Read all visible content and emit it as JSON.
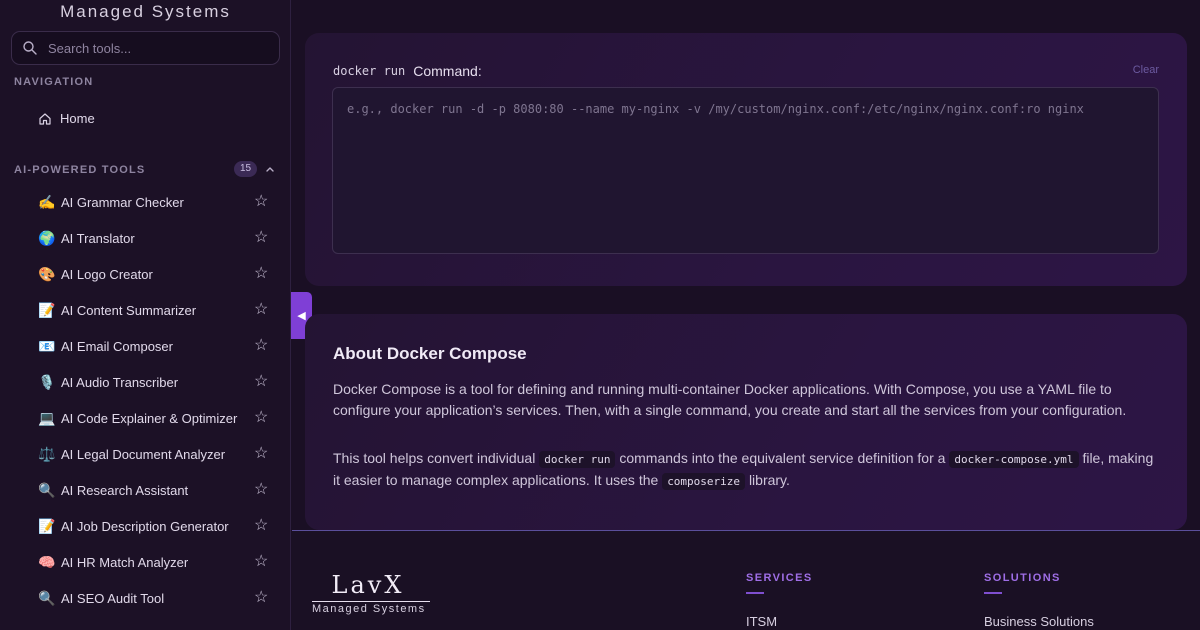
{
  "sidebar": {
    "brand_subtitle": "Managed Systems",
    "search_placeholder": "Search tools...",
    "nav_label": "NAVIGATION",
    "home_label": "Home",
    "tools_label": "AI-POWERED TOOLS",
    "tools_count": "15",
    "tools": [
      {
        "emoji": "✍️",
        "label": "AI Grammar Checker"
      },
      {
        "emoji": "🌍",
        "label": "AI Translator"
      },
      {
        "emoji": "🎨",
        "label": "AI Logo Creator"
      },
      {
        "emoji": "📝",
        "label": "AI Content Summarizer"
      },
      {
        "emoji": "📧",
        "label": "AI Email Composer"
      },
      {
        "emoji": "🎙️",
        "label": "AI Audio Transcriber"
      },
      {
        "emoji": "💻",
        "label": "AI Code Explainer & Optimizer"
      },
      {
        "emoji": "⚖️",
        "label": "AI Legal Document Analyzer"
      },
      {
        "emoji": "🔍",
        "label": "AI Research Assistant"
      },
      {
        "emoji": "📝",
        "label": "AI Job Description Generator"
      },
      {
        "emoji": "🧠",
        "label": "AI HR Match Analyzer"
      },
      {
        "emoji": "🔍",
        "label": "AI SEO Audit Tool"
      }
    ]
  },
  "main": {
    "command": {
      "code_label": "docker run",
      "label": "Command:",
      "clear_label": "Clear",
      "placeholder": "e.g., docker run -d -p 8080:80 --name my-nginx -v /my/custom/nginx.conf:/etc/nginx/nginx.conf:ro nginx"
    },
    "about": {
      "title": "About Docker Compose",
      "p1": "Docker Compose is a tool for defining and running multi-container Docker applications. With Compose, you use a YAML file to configure your application’s services. Then, with a single command, you create and start all the services from your configuration.",
      "p2_a": "This tool helps convert individual",
      "p2_code1": "docker run",
      "p2_b": "commands into the equivalent service definition for a",
      "p2_code2": "docker-compose.yml",
      "p2_c": "file, making it easier to manage complex applications. It uses the",
      "p2_code3": "composerize",
      "p2_d": "library."
    }
  },
  "footer": {
    "logo_text": "LavX",
    "logo_sub": "Managed Systems",
    "services_heading": "SERVICES",
    "services_first": "ITSM",
    "solutions_heading": "SOLUTIONS",
    "solutions_first": "Business Solutions"
  },
  "icons": {
    "search": "search-icon",
    "home": "home-icon",
    "star": "star-icon",
    "collapse": "chevron-left-icon",
    "section_toggle": "chevron-up-icon"
  },
  "colors": {
    "accent": "#7f3fd6",
    "footer_heading": "#9f6ee6",
    "clear_link": "#6c5aa0"
  }
}
